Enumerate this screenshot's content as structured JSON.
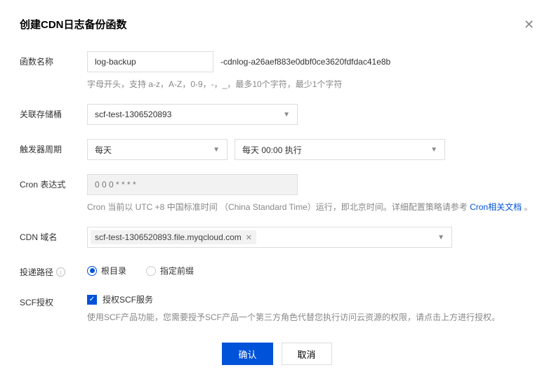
{
  "header": {
    "title": "创建CDN日志备份函数"
  },
  "fn": {
    "label": "函数名称",
    "value": "log-backup",
    "suffix": "-cdnlog-a26aef883e0dbf0ce3620fdfdac41e8b",
    "hint": "字母开头，支持 a-z，A-Z，0-9，-，_，最多10个字符，最少1个字符"
  },
  "bucket": {
    "label": "关联存储桶",
    "value": "scf-test-1306520893"
  },
  "trigger": {
    "label": "触发器周期",
    "period": "每天",
    "time": "每天 00:00 执行"
  },
  "cron": {
    "label": "Cron 表达式",
    "placeholder": "0 0 0 * * * *",
    "hint_prefix": "Cron 当前以 UTC +8 中国标准时间 （China Standard Time）运行，即北京时间。详细配置策略请参考 ",
    "hint_link": "Cron相关文档",
    "hint_suffix": " 。"
  },
  "domain": {
    "label": "CDN 域名",
    "tag": "scf-test-1306520893.file.myqcloud.com"
  },
  "path": {
    "label": "投递路径",
    "opt_root": "根目录",
    "opt_prefix": "指定前缀"
  },
  "scf": {
    "label": "SCF授权",
    "checkbox_label": "授权SCF服务",
    "hint": "使用SCF产品功能，您需要授予SCF产品一个第三方角色代替您执行访问云资源的权限，请点击上方进行授权。"
  },
  "footer": {
    "ok": "确认",
    "cancel": "取消"
  }
}
